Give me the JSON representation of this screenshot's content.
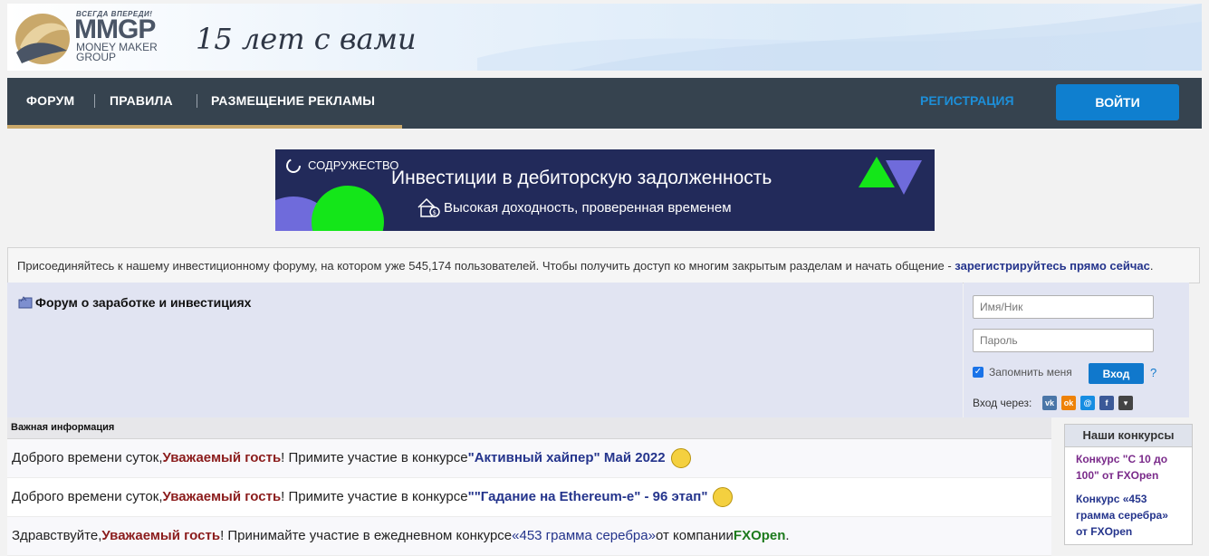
{
  "header": {
    "logo_tagline": "ВСЕГДА ВПЕРЕДИ!",
    "logo_main": "MMGP",
    "logo_sub1": "MONEY MAKER",
    "logo_sub2": "GROUP",
    "slogan": "15 лет с вами"
  },
  "nav": {
    "items": [
      "ФОРУМ",
      "ПРАВИЛА",
      "РАЗМЕЩЕНИЕ РЕКЛАМЫ"
    ],
    "register": "РЕГИСТРАЦИЯ",
    "login": "ВОЙТИ",
    "accent": "#c9a86a"
  },
  "ad": {
    "brand": "СОДРУЖЕСТВО",
    "title": "Инвестиции в дебиторскую задолженность",
    "subtitle": "Высокая доходность, проверенная временем"
  },
  "notice": {
    "text": "Присоединяйтесь к нашему инвестиционному форуму, на котором уже 545,174 пользователей. Чтобы получить доступ ко многим закрытым разделам и начать общение - ",
    "link": "зарегистрируйтесь прямо сейчас",
    "end": "."
  },
  "forum": {
    "title": "Форум о заработке и инвестициях"
  },
  "login_box": {
    "username_placeholder": "Имя/Ник",
    "password_placeholder": "Пароль",
    "remember": "Запомнить меня",
    "button": "Вход",
    "help": "?",
    "social_label": "Вход через:"
  },
  "info": {
    "header": "Важная информация",
    "row1": {
      "pre": "Доброго времени суток, ",
      "guest": "Уважаемый гость",
      "mid": "! Примите участие в конкурсе ",
      "contest": "\"Активный хайпер\" Май 2022"
    },
    "row2": {
      "pre": "Доброго времени суток, ",
      "guest": "Уважаемый гость",
      "mid": "! Примите участие в конкурсе ",
      "contest": "\"\"Гадание на Ethereum-е\" - 96 этап\""
    },
    "row3": {
      "pre": "Здравствуйте, ",
      "guest": "Уважаемый гость",
      "mid": "! Принимайте участие в ежедневном конкурсе ",
      "contest": "«453 грамма серебра»",
      "mid2": " от компании ",
      "company": "FXOpen",
      "end": "."
    }
  },
  "contests": {
    "header": "Наши конкурсы",
    "items": [
      {
        "text": "Конкурс \"С 10 до 100\" от FXOpen",
        "color": "#7a2a8a"
      },
      {
        "text": "Конкурс «453 грамма серебра» от FXOpen",
        "color": "#24348c"
      }
    ]
  }
}
